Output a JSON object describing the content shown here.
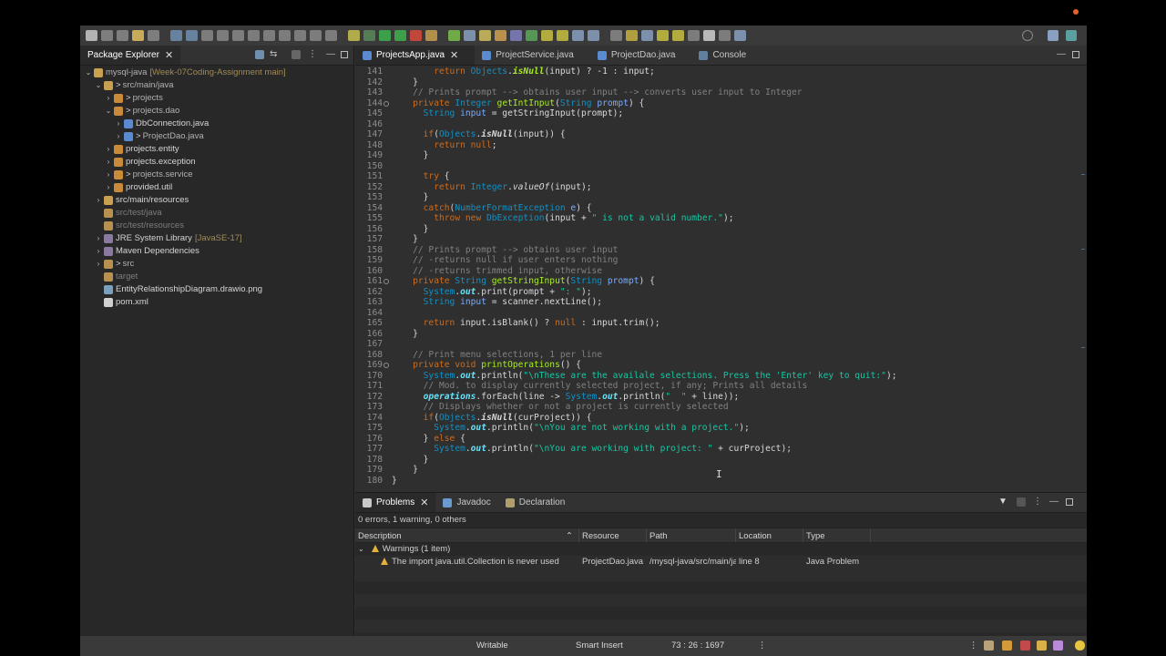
{
  "package_explorer": {
    "tab_label": "Package Explorer",
    "tree": [
      {
        "indent": 0,
        "arrow": "⌄",
        "icon": "project-icon",
        "label": "mysql-java",
        "deco": "[Week-07Coding-Assignment main]",
        "git": true
      },
      {
        "indent": 1,
        "arrow": "⌄",
        "icon": "source-folder-icon",
        "prefix": ">",
        "label": "src/main/java",
        "git": true
      },
      {
        "indent": 2,
        "arrow": "›",
        "icon": "package-icon",
        "prefix": ">",
        "label": "projects",
        "git": true
      },
      {
        "indent": 2,
        "arrow": "⌄",
        "icon": "package-icon",
        "prefix": ">",
        "label": "projects.dao",
        "git": true
      },
      {
        "indent": 3,
        "arrow": "›",
        "icon": "java-file-icon",
        "label": "DbConnection.java"
      },
      {
        "indent": 3,
        "arrow": "›",
        "icon": "java-file-warning-icon",
        "prefix": ">",
        "label": "ProjectDao.java",
        "git": true
      },
      {
        "indent": 2,
        "arrow": "›",
        "icon": "package-icon",
        "label": "projects.entity"
      },
      {
        "indent": 2,
        "arrow": "›",
        "icon": "package-icon",
        "label": "projects.exception"
      },
      {
        "indent": 2,
        "arrow": "›",
        "icon": "package-icon",
        "prefix": ">",
        "label": "projects.service",
        "git": true
      },
      {
        "indent": 2,
        "arrow": "›",
        "icon": "package-icon",
        "label": "provided.util"
      },
      {
        "indent": 1,
        "arrow": "›",
        "icon": "source-folder-icon",
        "label": "src/main/resources"
      },
      {
        "indent": 1,
        "arrow": "",
        "icon": "folder-icon",
        "label": "src/test/java",
        "dim": true
      },
      {
        "indent": 1,
        "arrow": "",
        "icon": "folder-icon",
        "label": "src/test/resources",
        "dim": true
      },
      {
        "indent": 1,
        "arrow": "›",
        "icon": "library-icon",
        "label": "JRE System Library",
        "deco": "[JavaSE-17]"
      },
      {
        "indent": 1,
        "arrow": "›",
        "icon": "library-icon",
        "label": "Maven Dependencies"
      },
      {
        "indent": 1,
        "arrow": "›",
        "icon": "folder-icon",
        "prefix": ">",
        "label": "src",
        "git": true
      },
      {
        "indent": 1,
        "arrow": "",
        "icon": "folder-icon",
        "label": "target",
        "dim": true
      },
      {
        "indent": 1,
        "arrow": "",
        "icon": "image-file-icon",
        "label": "EntityRelationshipDiagram.drawio.png"
      },
      {
        "indent": 1,
        "arrow": "",
        "icon": "xml-file-icon",
        "label": "pom.xml"
      }
    ]
  },
  "editor": {
    "tabs": [
      {
        "label": "ProjectsApp.java",
        "active": true
      },
      {
        "label": "ProjectService.java"
      },
      {
        "label": "ProjectDao.java"
      },
      {
        "label": "Console"
      }
    ],
    "lines": [
      {
        "n": "141",
        "html": "        <span class=\"kw\">return</span> <span class=\"ty\">Objects</span>.<span class=\"mth it bo\">isNull</span>(input) ? -1 : input;"
      },
      {
        "n": "142",
        "html": "    }"
      },
      {
        "n": "143",
        "html": "    <span class=\"cm\">// Prints prompt --> obtains user input --> converts user input to Integer</span>"
      },
      {
        "n": "144",
        "fold": true,
        "html": "    <span class=\"kw\">private</span> <span class=\"ty\">Integer</span> <span class=\"mth\">getIntInput</span>(<span class=\"ty\">String</span> <span class=\"var\">prompt</span>) {"
      },
      {
        "n": "145",
        "html": "      <span class=\"ty\">String</span> <span class=\"var\">input</span> = getStringInput(prompt);"
      },
      {
        "n": "146",
        "html": ""
      },
      {
        "n": "147",
        "html": "      <span class=\"kw\">if</span>(<span class=\"ty\">Objects</span>.<span class=\"it bo\">isNull</span>(input)) {"
      },
      {
        "n": "148",
        "html": "        <span class=\"kw\">return</span> <span class=\"kw\">null</span>;"
      },
      {
        "n": "149",
        "html": "      }"
      },
      {
        "n": "150",
        "html": ""
      },
      {
        "n": "151",
        "html": "      <span class=\"kw\">try</span> {"
      },
      {
        "n": "152",
        "html": "        <span class=\"kw\">return</span> <span class=\"ty\">Integer</span>.<span class=\"it\">valueOf</span>(input);"
      },
      {
        "n": "153",
        "html": "      }"
      },
      {
        "n": "154",
        "html": "      <span class=\"kw\">catch</span>(<span class=\"ty\">NumberFormatException</span> <span class=\"var\">e</span>) {"
      },
      {
        "n": "155",
        "html": "        <span class=\"kw\">throw</span> <span class=\"kw\">new</span> <span class=\"ty\">DbException</span>(input + <span class=\"str\">\" is not a valid number.\"</span>);"
      },
      {
        "n": "156",
        "html": "      }"
      },
      {
        "n": "157",
        "html": "    }"
      },
      {
        "n": "158",
        "html": "    <span class=\"cm\">// Prints prompt --> obtains user input</span>"
      },
      {
        "n": "159",
        "html": "    <span class=\"cm\">// -returns null if user enters nothing</span>"
      },
      {
        "n": "160",
        "html": "    <span class=\"cm\">// -returns trimmed input, otherwise</span>"
      },
      {
        "n": "161",
        "fold": true,
        "html": "    <span class=\"kw\">private</span> <span class=\"ty\">String</span> <span class=\"mth\">getStringInput</span>(<span class=\"ty\">String</span> <span class=\"var\">prompt</span>) {"
      },
      {
        "n": "162",
        "html": "      <span class=\"ty\">System</span>.<span class=\"fld\">out</span>.print(prompt + <span class=\"str\">\": \"</span>);"
      },
      {
        "n": "163",
        "html": "      <span class=\"ty\">String</span> <span class=\"var\">input</span> = scanner.nextLine();"
      },
      {
        "n": "164",
        "html": ""
      },
      {
        "n": "165",
        "html": "      <span class=\"kw\">return</span> input.isBlank() ? <span class=\"kw\">null</span> : input.trim();"
      },
      {
        "n": "166",
        "html": "    }"
      },
      {
        "n": "167",
        "html": ""
      },
      {
        "n": "168",
        "html": "    <span class=\"cm\">// Print menu selections, 1 per line</span>"
      },
      {
        "n": "169",
        "fold": true,
        "html": "    <span class=\"kw\">private</span> <span class=\"kw\">void</span> <span class=\"mth\">printOperations</span>() {"
      },
      {
        "n": "170",
        "html": "      <span class=\"ty\">System</span>.<span class=\"fld\">out</span>.println(<span class=\"str\">\"\\nThese are the availale selections. Press the 'Enter' key to quit:\"</span>);"
      },
      {
        "n": "171",
        "html": "      <span class=\"cm\">// Mod. to display currently selected project, if any; Prints all details</span>"
      },
      {
        "n": "172",
        "html": "      <span class=\"fld\">operations</span>.forEach(line -> <span class=\"ty\">System</span>.<span class=\"fld\">out</span>.println(<span class=\"str\">\"  \"</span> + line));"
      },
      {
        "n": "173",
        "html": "      <span class=\"cm\">// Displays whether or not a project is currently selected</span>"
      },
      {
        "n": "174",
        "html": "      <span class=\"kw\">if</span>(<span class=\"ty\">Objects</span>.<span class=\"it bo\">isNull</span>(curProject)) {"
      },
      {
        "n": "175",
        "html": "        <span class=\"ty\">System</span>.<span class=\"fld\">out</span>.println(<span class=\"str\">\"\\nYou are not working with a project.\"</span>);"
      },
      {
        "n": "176",
        "html": "      } <span class=\"kw\">else</span> {"
      },
      {
        "n": "177",
        "html": "        <span class=\"ty\">System</span>.<span class=\"fld\">out</span>.println(<span class=\"str\">\"\\nYou are working with project: \"</span> + curProject);"
      },
      {
        "n": "178",
        "html": "      }"
      },
      {
        "n": "179",
        "html": "    }"
      },
      {
        "n": "180",
        "html": "}"
      }
    ]
  },
  "problems_view": {
    "tabs": [
      {
        "label": "Problems",
        "icon": "problems-icon",
        "active": true
      },
      {
        "label": "Javadoc",
        "icon": "at-icon"
      },
      {
        "label": "Declaration",
        "icon": "declaration-icon"
      }
    ],
    "summary": "0 errors, 1 warning, 0 others",
    "columns": [
      "Description",
      "Resource",
      "Path",
      "Location",
      "Type"
    ],
    "group_label": "Warnings (1 item)",
    "rows": [
      {
        "description": "The import java.util.Collection is never used",
        "resource": "ProjectDao.java",
        "path": "/mysql-java/src/main/ja",
        "location": "line 8",
        "type": "Java Problem"
      }
    ]
  },
  "status_bar": {
    "writable": "Writable",
    "insert_mode": "Smart Insert",
    "position": "73 : 26 : 1697"
  },
  "colors": {
    "background": "#2f2f2f",
    "keyword": "#cc6c1d",
    "type": "#1290c3",
    "string": "#17c6a3",
    "comment": "#808080",
    "method": "#a7ec21"
  }
}
